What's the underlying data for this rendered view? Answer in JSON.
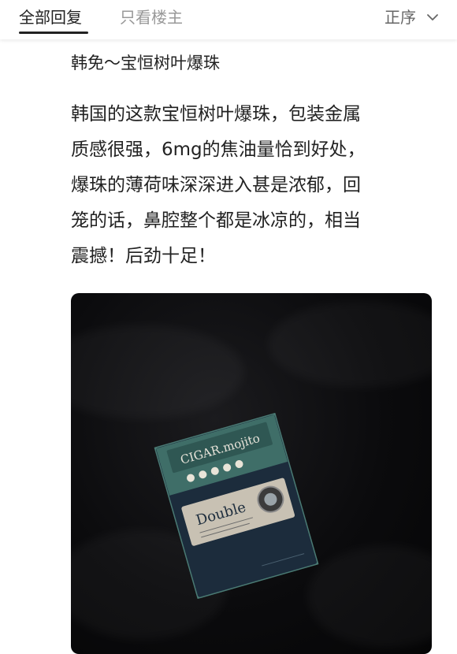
{
  "tabs": {
    "all_label": "全部回复",
    "owner_only_label": "只看楼主",
    "sort_label": "正序"
  },
  "post": {
    "title": "韩免～宝恒树叶爆珠",
    "body": "韩国的这款宝恒树叶爆珠，包装金属\n质感很强，6mg的焦油量恰到好处，\n爆珠的薄荷味深深进入甚是浓郁，回\n笼的话，鼻腔整个都是冰凉的，相当\n震撼！后劲十足！"
  },
  "image": {
    "pack_brand": "CIGAR.mojito",
    "pack_label": "Double"
  },
  "colors": {
    "pack_teal": "#3f6e68",
    "pack_dark": "#1c2c3c",
    "label_beige": "#c8c1b3"
  },
  "icons": {
    "sort": "chevron-down-icon"
  }
}
